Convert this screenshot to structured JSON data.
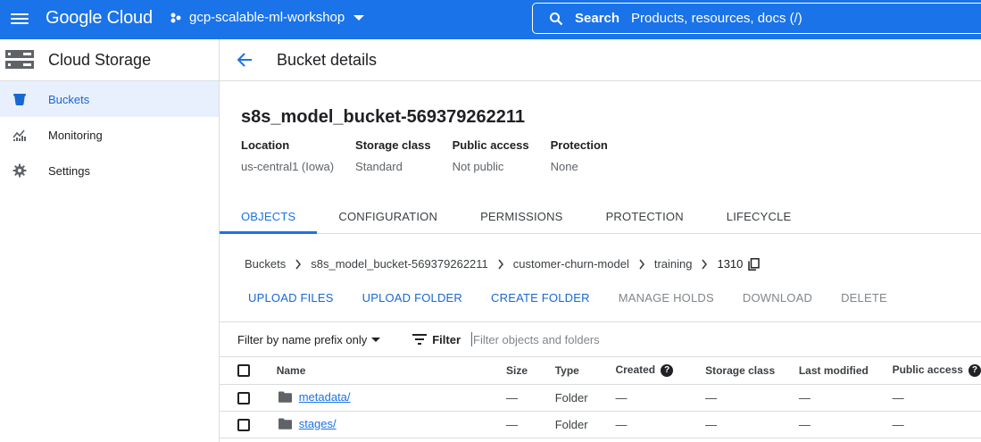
{
  "topbar": {
    "brand": "Google Cloud",
    "project": "gcp-scalable-ml-workshop",
    "search_label": "Search",
    "search_placeholder": "Products, resources, docs (/)",
    "accent": "#1a73e8"
  },
  "sidebar": {
    "title": "Cloud Storage",
    "items": [
      {
        "label": "Buckets",
        "icon": "bucket-icon",
        "active": true
      },
      {
        "label": "Monitoring",
        "icon": "chart-icon",
        "active": false
      },
      {
        "label": "Settings",
        "icon": "gear-icon",
        "active": false
      }
    ]
  },
  "header": {
    "title": "Bucket details"
  },
  "bucket": {
    "name": "s8s_model_bucket-569379262211",
    "props": [
      {
        "key": "Location",
        "value": "us-central1 (Iowa)"
      },
      {
        "key": "Storage class",
        "value": "Standard"
      },
      {
        "key": "Public access",
        "value": "Not public"
      },
      {
        "key": "Protection",
        "value": "None"
      }
    ]
  },
  "tabs": [
    "OBJECTS",
    "CONFIGURATION",
    "PERMISSIONS",
    "PROTECTION",
    "LIFECYCLE"
  ],
  "breadcrumb": [
    "Buckets",
    "s8s_model_bucket-569379262211",
    "customer-churn-model",
    "training",
    "1310"
  ],
  "actions": [
    {
      "label": "UPLOAD FILES",
      "enabled": true
    },
    {
      "label": "UPLOAD FOLDER",
      "enabled": true
    },
    {
      "label": "CREATE FOLDER",
      "enabled": true
    },
    {
      "label": "MANAGE HOLDS",
      "enabled": false
    },
    {
      "label": "DOWNLOAD",
      "enabled": false
    },
    {
      "label": "DELETE",
      "enabled": false
    }
  ],
  "filter": {
    "prefix_label": "Filter by name prefix only",
    "filter_label": "Filter",
    "placeholder": "Filter objects and folders"
  },
  "table": {
    "columns": [
      "Name",
      "Size",
      "Type",
      "Created",
      "Storage class",
      "Last modified",
      "Public access"
    ],
    "rows": [
      {
        "name": "metadata/",
        "size": "—",
        "type": "Folder",
        "created": "—",
        "storage": "—",
        "modified": "—",
        "public": "—"
      },
      {
        "name": "stages/",
        "size": "—",
        "type": "Folder",
        "created": "—",
        "storage": "—",
        "modified": "—",
        "public": "—"
      }
    ]
  }
}
